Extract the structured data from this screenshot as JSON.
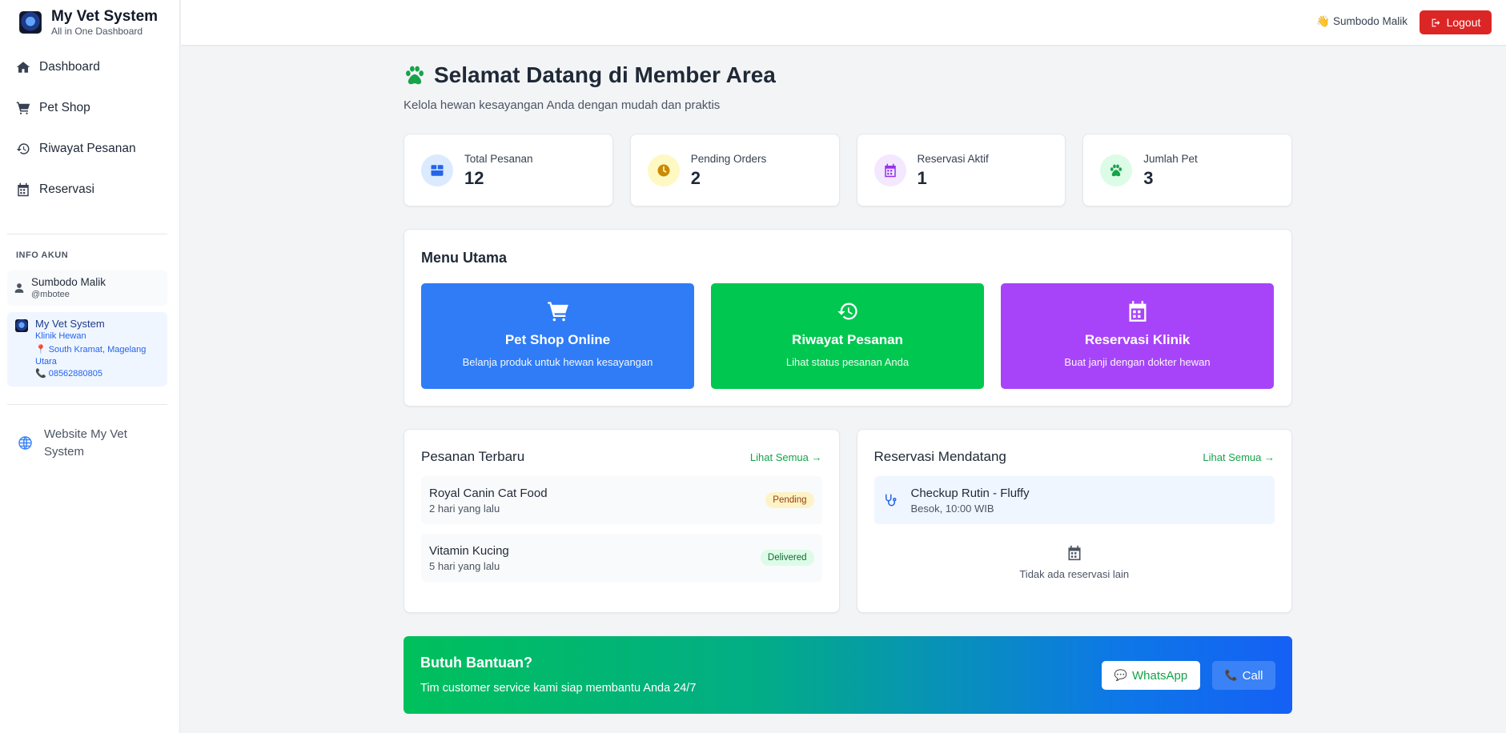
{
  "brand": {
    "title": "My Vet System",
    "subtitle": "All in One Dashboard"
  },
  "sidebar": {
    "nav": [
      {
        "label": "Dashboard",
        "icon": "home-icon"
      },
      {
        "label": "Pet Shop",
        "icon": "cart-icon"
      },
      {
        "label": "Riwayat Pesanan",
        "icon": "history-icon"
      },
      {
        "label": "Reservasi",
        "icon": "calendar-icon"
      }
    ],
    "info_title": "INFO AKUN",
    "user": {
      "name": "Sumbodo Malik",
      "handle": "@mbotee"
    },
    "clinic": {
      "name": "My Vet System",
      "type": "Klinik Hewan",
      "address": "South Kramat, Magelang Utara",
      "phone": "08562880805"
    },
    "website_link": "Website My Vet System"
  },
  "header": {
    "user_label": "👋 Sumbodo Malik",
    "logout_label": "Logout"
  },
  "welcome": {
    "title": "Selamat Datang di Member Area",
    "subtitle": "Kelola hewan kesayangan Anda dengan mudah dan praktis"
  },
  "stats": [
    {
      "label": "Total Pesanan",
      "value": "12",
      "icon": "box-icon",
      "color": "#2563eb",
      "bg": "#dbeafe"
    },
    {
      "label": "Pending Orders",
      "value": "2",
      "icon": "clock-icon",
      "color": "#ca8a04",
      "bg": "#fef9c3"
    },
    {
      "label": "Reservasi Aktif",
      "value": "1",
      "icon": "calendar-icon",
      "color": "#9333ea",
      "bg": "#f3e8ff"
    },
    {
      "label": "Jumlah Pet",
      "value": "3",
      "icon": "paw-icon",
      "color": "#16a34a",
      "bg": "#dcfce7"
    }
  ],
  "menu": {
    "title": "Menu Utama",
    "tiles": [
      {
        "title": "Pet Shop Online",
        "desc": "Belanja produk untuk hewan kesayangan",
        "color": "#2f7cf6"
      },
      {
        "title": "Riwayat Pesanan",
        "desc": "Lihat status pesanan Anda",
        "color": "#00c74f"
      },
      {
        "title": "Reservasi Klinik",
        "desc": "Buat janji dengan dokter hewan",
        "color": "#a744f9"
      }
    ]
  },
  "orders": {
    "title": "Pesanan Terbaru",
    "link": "Lihat Semua →",
    "items": [
      {
        "name": "Royal Canin Cat Food",
        "time": "2 hari yang lalu",
        "status": "Pending"
      },
      {
        "name": "Vitamin Kucing",
        "time": "5 hari yang lalu",
        "status": "Delivered"
      }
    ]
  },
  "reservations": {
    "title": "Reservasi Mendatang",
    "link": "Lihat Semua →",
    "item": {
      "name": "Checkup Rutin - Fluffy",
      "time": "Besok, 10:00 WIB"
    },
    "empty_text": "Tidak ada reservasi lain"
  },
  "help": {
    "title": "Butuh Bantuan?",
    "subtitle": "Tim customer service kami siap membantu Anda 24/7",
    "whatsapp_label": "WhatsApp",
    "call_label": "Call"
  }
}
